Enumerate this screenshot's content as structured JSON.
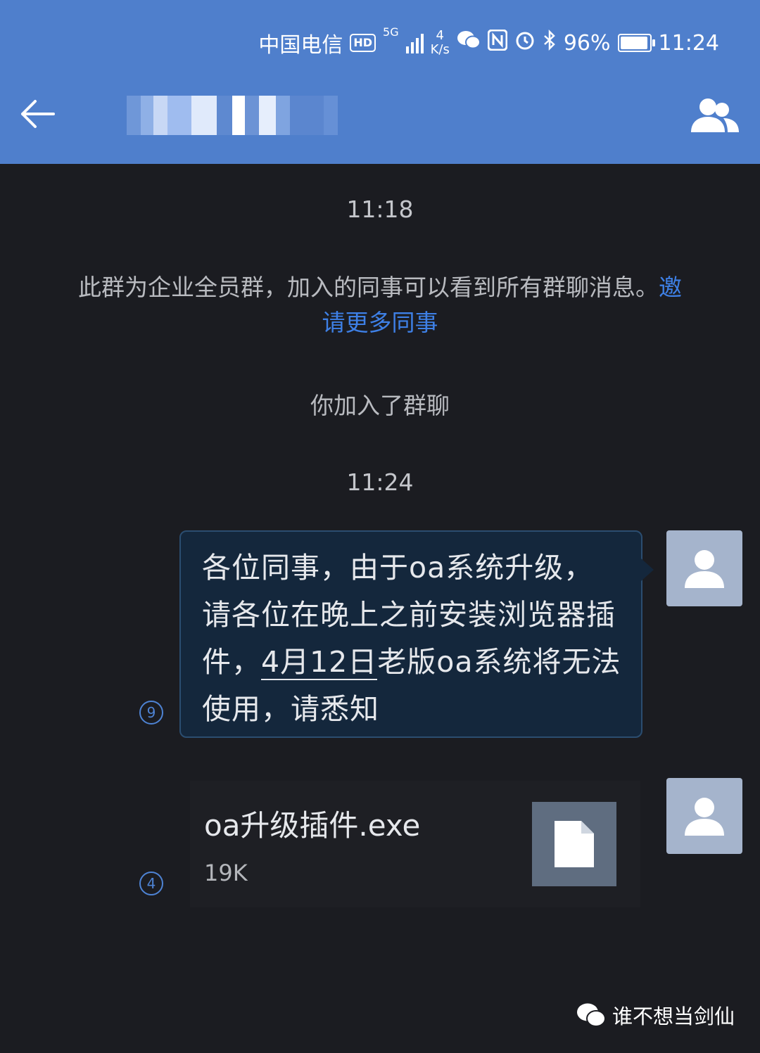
{
  "status_bar": {
    "carrier": "中国电信",
    "hd": "HD",
    "network": "5G",
    "speed_value": "4",
    "speed_unit": "K/s",
    "battery": "96%",
    "time": "11:24"
  },
  "header": {
    "chat_title_blurred": true
  },
  "timeline": {
    "time_1": "11:18",
    "notice_text": "此群为企业全员群，加入的同事可以看到所有群聊消息。",
    "invite_link": "邀请更多同事",
    "join_text": "你加入了群聊",
    "time_2": "11:24"
  },
  "messages": [
    {
      "text_before": "各位同事，由于oa系统升级，请各位在晚上之前安装浏览器插件，",
      "date_link": "4月12日",
      "text_after": "老版oa系统将无法使用，请悉知",
      "read_count": "9"
    }
  ],
  "file_message": {
    "name": "oa升级插件.exe",
    "size": "19K",
    "read_count": "4"
  },
  "watermark": {
    "text": "谁不想当剑仙"
  },
  "colors": {
    "header": "#4f7fcc",
    "background": "#1b1c21",
    "bubble": "#14273c",
    "link": "#3e80e6"
  }
}
